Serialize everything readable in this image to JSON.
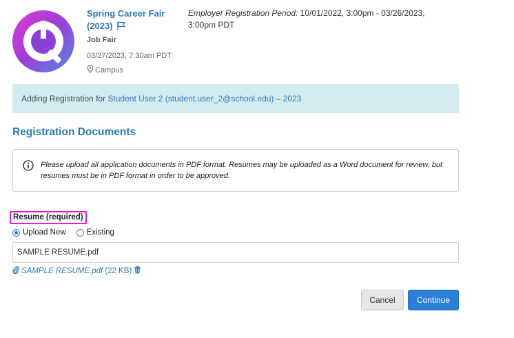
{
  "event": {
    "title_line1": "Spring Career Fair",
    "title_line2": "(2023)",
    "type": "Job Fair",
    "date": "03/27/2023, 7:30am PDT",
    "location": "Campus",
    "registration_period_label": "Employer Registration Period:",
    "registration_period_value": "10/01/2022, 3:00pm - 03/26/2023, 3:00pm PDT",
    "icons": {
      "logo": "purple-circle-logo",
      "flag": "flag-icon",
      "location": "map-pin-icon"
    }
  },
  "alert": {
    "prefix": "Adding Registration for",
    "student": "Student User 2 (student.user_2@school.edu) – 2023"
  },
  "documents": {
    "section_title": "Registration Documents",
    "info_text": "Please upload all application documents in PDF format. Resumes may be uploaded as a Word document for review, but resumes must be in PDF format in order to be approved.",
    "resume_label": "Resume (required)",
    "upload_new_label": "Upload New",
    "existing_label": "Existing",
    "selected_option": "Upload New",
    "file_value": "SAMPLE RESUME.pdf",
    "attachment_name": "SAMPLE RESUME.pdf",
    "attachment_size": "(22 KB)"
  },
  "actions": {
    "cancel_label": "Cancel",
    "continue_label": "Continue"
  },
  "colors": {
    "link": "#2a7ab8",
    "primary_button": "#2b7fd9",
    "alert_bg": "#d4ebef",
    "highlight": "#e021d8"
  }
}
